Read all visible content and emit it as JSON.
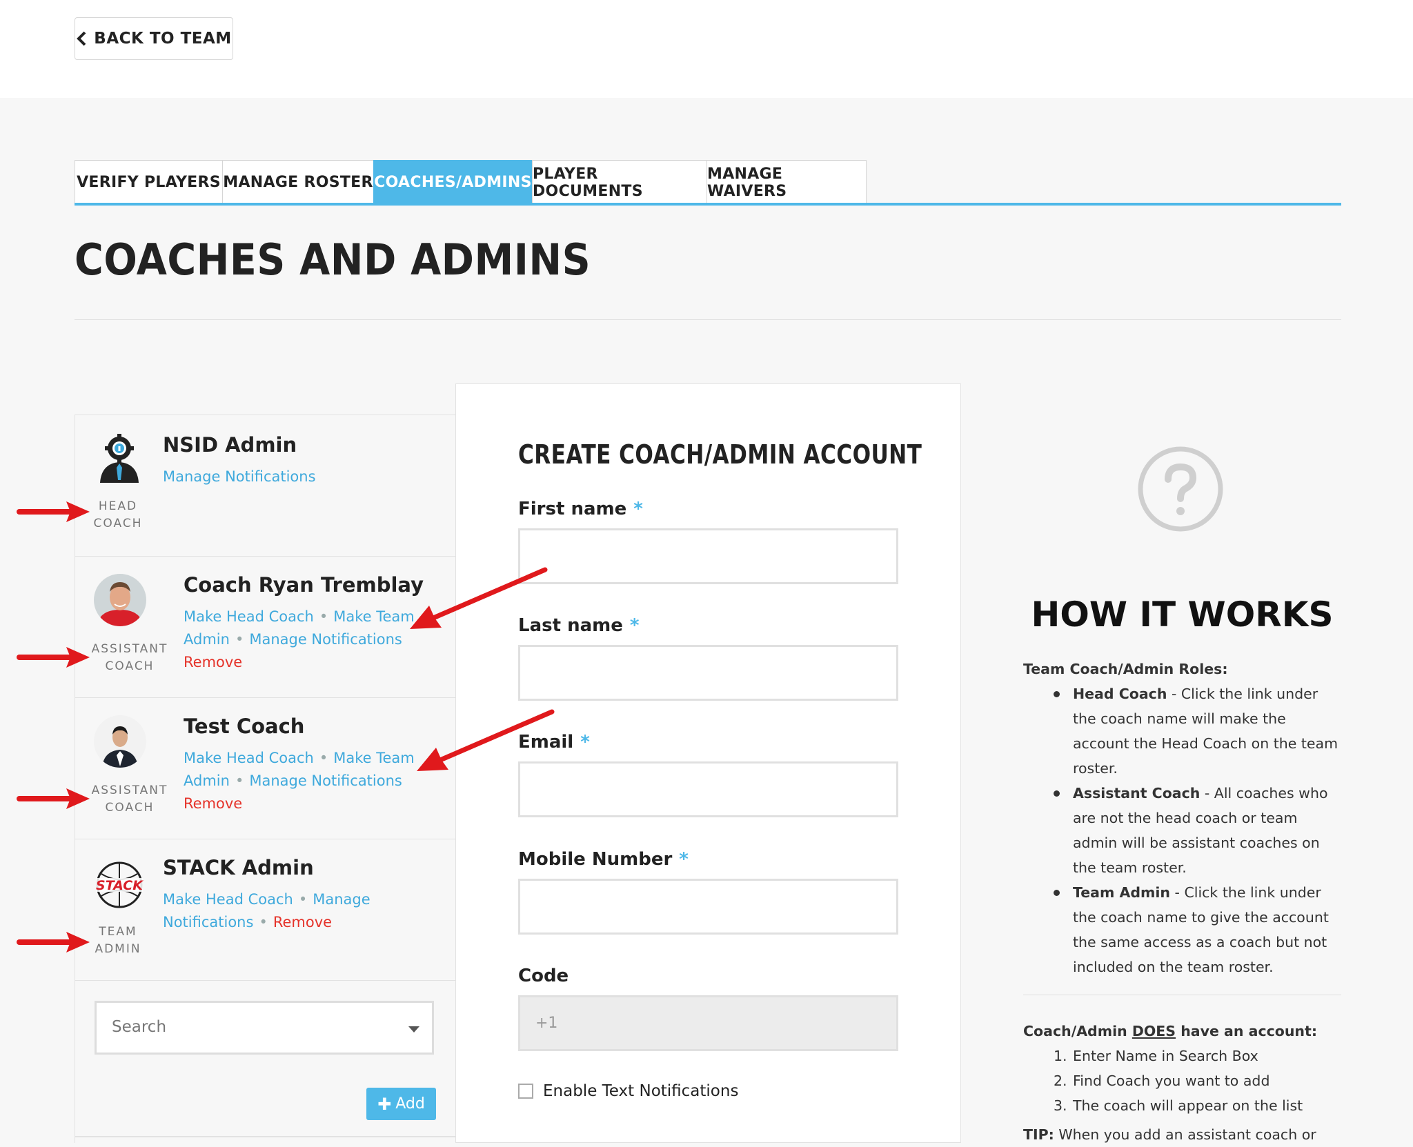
{
  "back_button": {
    "label": "BACK TO TEAM"
  },
  "tabs": [
    {
      "label": "VERIFY PLAYERS",
      "active": false
    },
    {
      "label": "MANAGE ROSTER",
      "active": false
    },
    {
      "label": "COACHES/ADMINS",
      "active": true
    },
    {
      "label": "PLAYER DOCUMENTS",
      "active": false
    },
    {
      "label": "MANAGE WAIVERS",
      "active": false
    }
  ],
  "page_title": "COACHES AND ADMINS",
  "coaches": [
    {
      "name": "NSID Admin",
      "role_line1": "HEAD",
      "role_line2": "COACH",
      "avatar": "gear-person-icon",
      "link_manage_notifications": "Manage Notifications"
    },
    {
      "name": "Coach Ryan Tremblay",
      "role_line1": "ASSISTANT",
      "role_line2": "COACH",
      "avatar": "photo",
      "link_make_head": "Make Head Coach",
      "link_make_admin_1": "Make Team",
      "link_make_admin_2": "Admin",
      "link_manage_notifications": "Manage Notifications",
      "link_remove": "Remove"
    },
    {
      "name": "Test Coach",
      "role_line1": "ASSISTANT",
      "role_line2": "COACH",
      "avatar": "photo",
      "link_make_head": "Make Head Coach",
      "link_make_admin_1": "Make Team",
      "link_make_admin_2": "Admin",
      "link_manage_notifications": "Manage Notifications",
      "link_remove": "Remove"
    },
    {
      "name": "STACK Admin",
      "role_line1": "TEAM",
      "role_line2": "ADMIN",
      "avatar": "stack-logo",
      "link_make_head": "Make Head Coach",
      "link_manage_1": "Manage",
      "link_manage_2": "Notifications",
      "link_remove": "Remove"
    }
  ],
  "search": {
    "placeholder": "Search"
  },
  "add_button": {
    "label": "Add"
  },
  "form": {
    "title": "CREATE COACH/ADMIN ACCOUNT",
    "first_name_label": "First name",
    "last_name_label": "Last name",
    "email_label": "Email",
    "mobile_label": "Mobile Number",
    "code_label": "Code",
    "code_value": "+1",
    "required_mark": "*",
    "enable_text_label": "Enable Text Notifications"
  },
  "how_it_works": {
    "title": "HOW IT WORKS",
    "roles_heading": "Team Coach/Admin Roles:",
    "head_term": "Head Coach",
    "head_desc": " - Click the link under the coach name will make the account the Head Coach on the team roster.",
    "assistant_term": "Assistant Coach",
    "assistant_desc": " - All coaches who are not the head coach or team admin will be assistant coaches on the team roster.",
    "admin_term": "Team Admin",
    "admin_desc": " - Click the link under the coach name to give the account the same access as a coach but not included on the team roster.",
    "does_heading_1": "Coach/Admin ",
    "does_heading_2": "DOES",
    "does_heading_3": " have an account:",
    "steps": [
      "Enter Name in Search Box",
      "Find Coach you want to add",
      "The coach will appear on the list"
    ],
    "tip_label": "TIP:",
    "tip_text": " When you add an assistant coach or"
  },
  "colors": {
    "accent": "#4eb8e8",
    "danger": "#e5332a",
    "arrow": "#e0191c"
  }
}
